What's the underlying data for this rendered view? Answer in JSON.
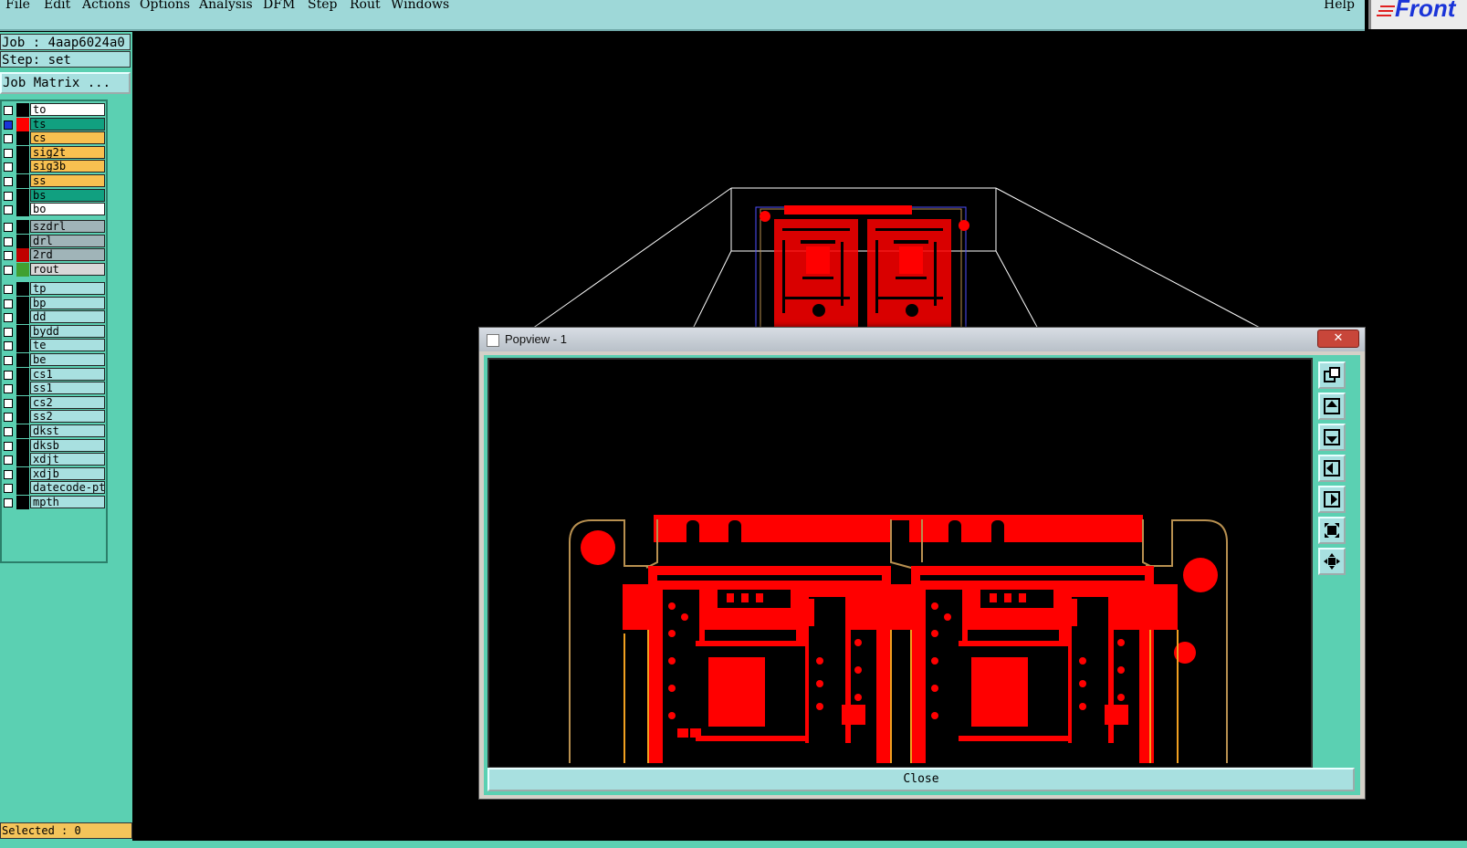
{
  "menu": {
    "items": [
      "File",
      "Edit",
      "Actions",
      "Options",
      "Analysis",
      "DFM",
      "Step",
      "Rout",
      "Windows"
    ],
    "help": "Help"
  },
  "logo": {
    "text": "Front"
  },
  "left": {
    "job": "Job : 4aap6024a0",
    "step": "Step: set",
    "matrix_button": "Job Matrix ...",
    "selected": "Selected : 0"
  },
  "layers": {
    "group1": [
      {
        "name": "to",
        "color": "#ffffff"
      },
      {
        "name": "ts",
        "color": "#11a080"
      },
      {
        "name": "cs",
        "color": "#f8c050"
      },
      {
        "name": "sig2t",
        "color": "#f8c050"
      },
      {
        "name": "sig3b",
        "color": "#f8c050"
      },
      {
        "name": "ss",
        "color": "#f8c050"
      },
      {
        "name": "bs",
        "color": "#11a080"
      },
      {
        "name": "bo",
        "color": "#ffffff"
      }
    ],
    "group2": [
      {
        "name": "szdrl",
        "color": "#a0b4b8"
      },
      {
        "name": "drl",
        "color": "#a0b4b8"
      },
      {
        "name": "2rd",
        "color": "#a0b4b8"
      },
      {
        "name": "rout",
        "color": "#d8d8d8"
      }
    ],
    "group3": [
      {
        "name": "tp",
        "color": "#a8e0e0"
      },
      {
        "name": "bp",
        "color": "#a8e0e0"
      },
      {
        "name": "dd",
        "color": "#a8e0e0"
      },
      {
        "name": "bydd",
        "color": "#a8e0e0"
      },
      {
        "name": "te",
        "color": "#a8e0e0"
      },
      {
        "name": "be",
        "color": "#a8e0e0"
      },
      {
        "name": "cs1",
        "color": "#a8e0e0"
      },
      {
        "name": "ss1",
        "color": "#a8e0e0"
      },
      {
        "name": "cs2",
        "color": "#a8e0e0"
      },
      {
        "name": "ss2",
        "color": "#a8e0e0"
      },
      {
        "name": "dkst",
        "color": "#a8e0e0"
      },
      {
        "name": "dksb",
        "color": "#a8e0e0"
      },
      {
        "name": "xdjt",
        "color": "#a8e0e0"
      },
      {
        "name": "xdjb",
        "color": "#a8e0e0"
      },
      {
        "name": "datecode-pte",
        "color": "#a8e0e0"
      },
      {
        "name": "mpth",
        "color": "#a8e0e0"
      }
    ]
  },
  "popview": {
    "title": "Popview - 1",
    "close_x": "✕",
    "close_button": "Close"
  },
  "colors": {
    "copper": "#ff0000",
    "outline": "#b89050",
    "panel": "#5bd0b2",
    "button": "#a8e0e0"
  }
}
